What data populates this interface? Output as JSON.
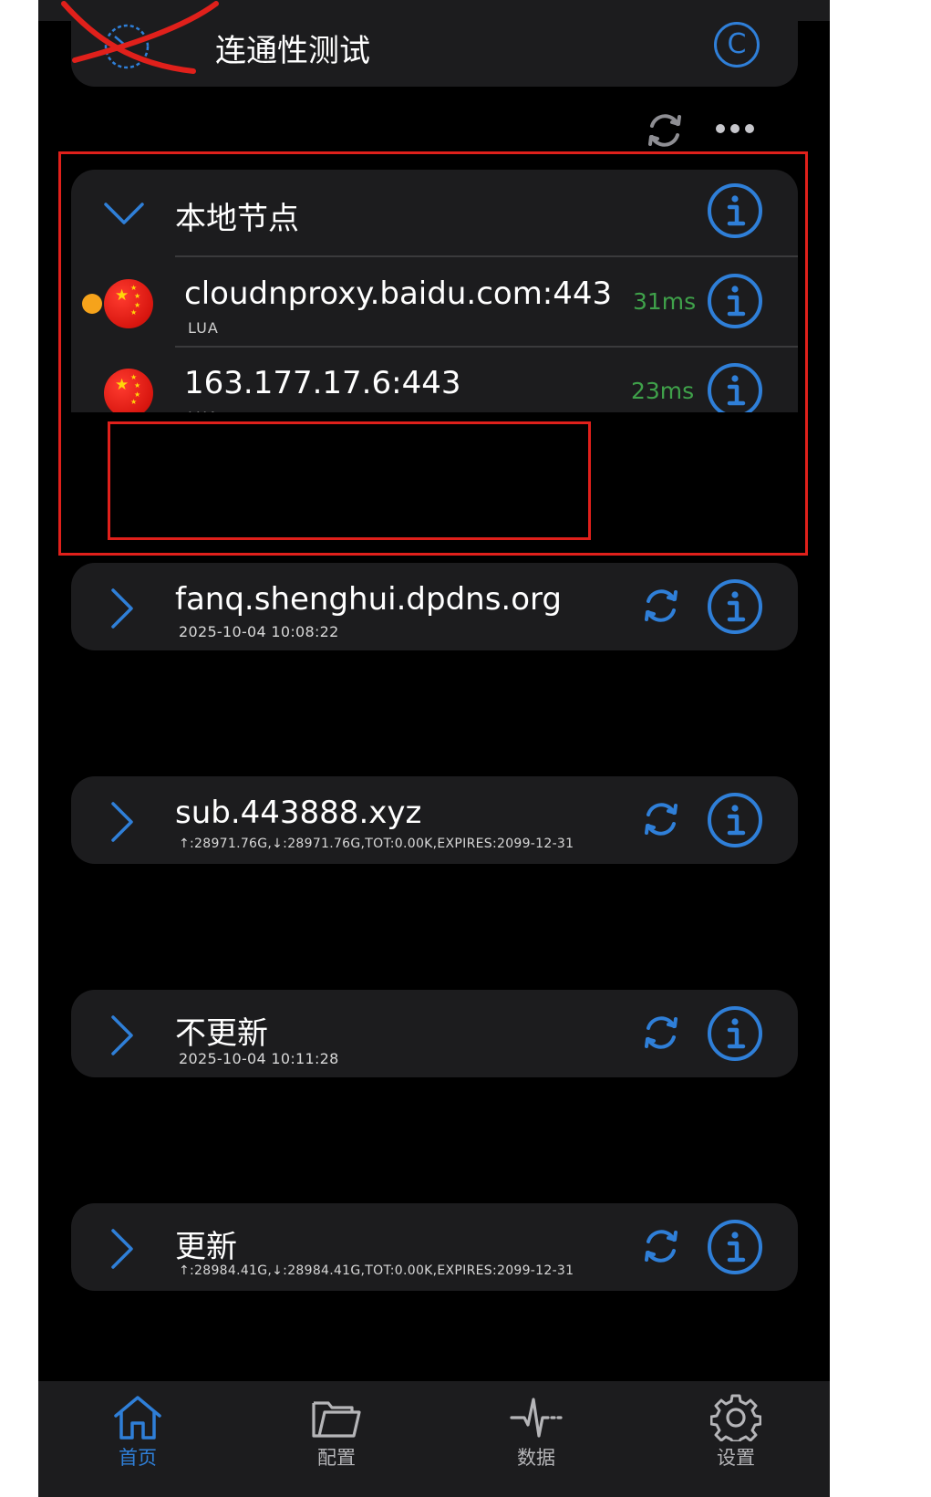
{
  "connectivity": {
    "title": "连通性测试",
    "badge": "C"
  },
  "local_group": {
    "title": "本地节点",
    "nodes": [
      {
        "name": "cloudnproxy.baidu.com:443",
        "type": "LUA",
        "latency": "31ms",
        "selected": true
      },
      {
        "name": "163.177.17.6:443",
        "type": "LUA",
        "latency": "23ms",
        "selected": false
      }
    ]
  },
  "subscriptions": [
    {
      "title": "fanq.shenghui.dpdns.org",
      "meta": "2025-10-04 10:08:22"
    },
    {
      "title": "sub.443888.xyz",
      "meta": "↑:28971.76G,↓:28971.76G,TOT:0.00K,EXPIRES:2099-12-31"
    },
    {
      "title": "不更新",
      "meta": "2025-10-04 10:11:28"
    },
    {
      "title": "更新",
      "meta": "↑:28984.41G,↓:28984.41G,TOT:0.00K,EXPIRES:2099-12-31"
    }
  ],
  "tabs": [
    {
      "label": "首页",
      "icon": "home-icon",
      "active": true
    },
    {
      "label": "配置",
      "icon": "folder-icon",
      "active": false
    },
    {
      "label": "数据",
      "icon": "pulse-icon",
      "active": false
    },
    {
      "label": "设置",
      "icon": "gear-icon",
      "active": false
    }
  ],
  "colors": {
    "accent": "#2f7fd8",
    "latency": "#3fa14a",
    "annotation": "#e0201b",
    "card_bg": "#1c1c1e",
    "selected_dot": "#f6a31b"
  }
}
